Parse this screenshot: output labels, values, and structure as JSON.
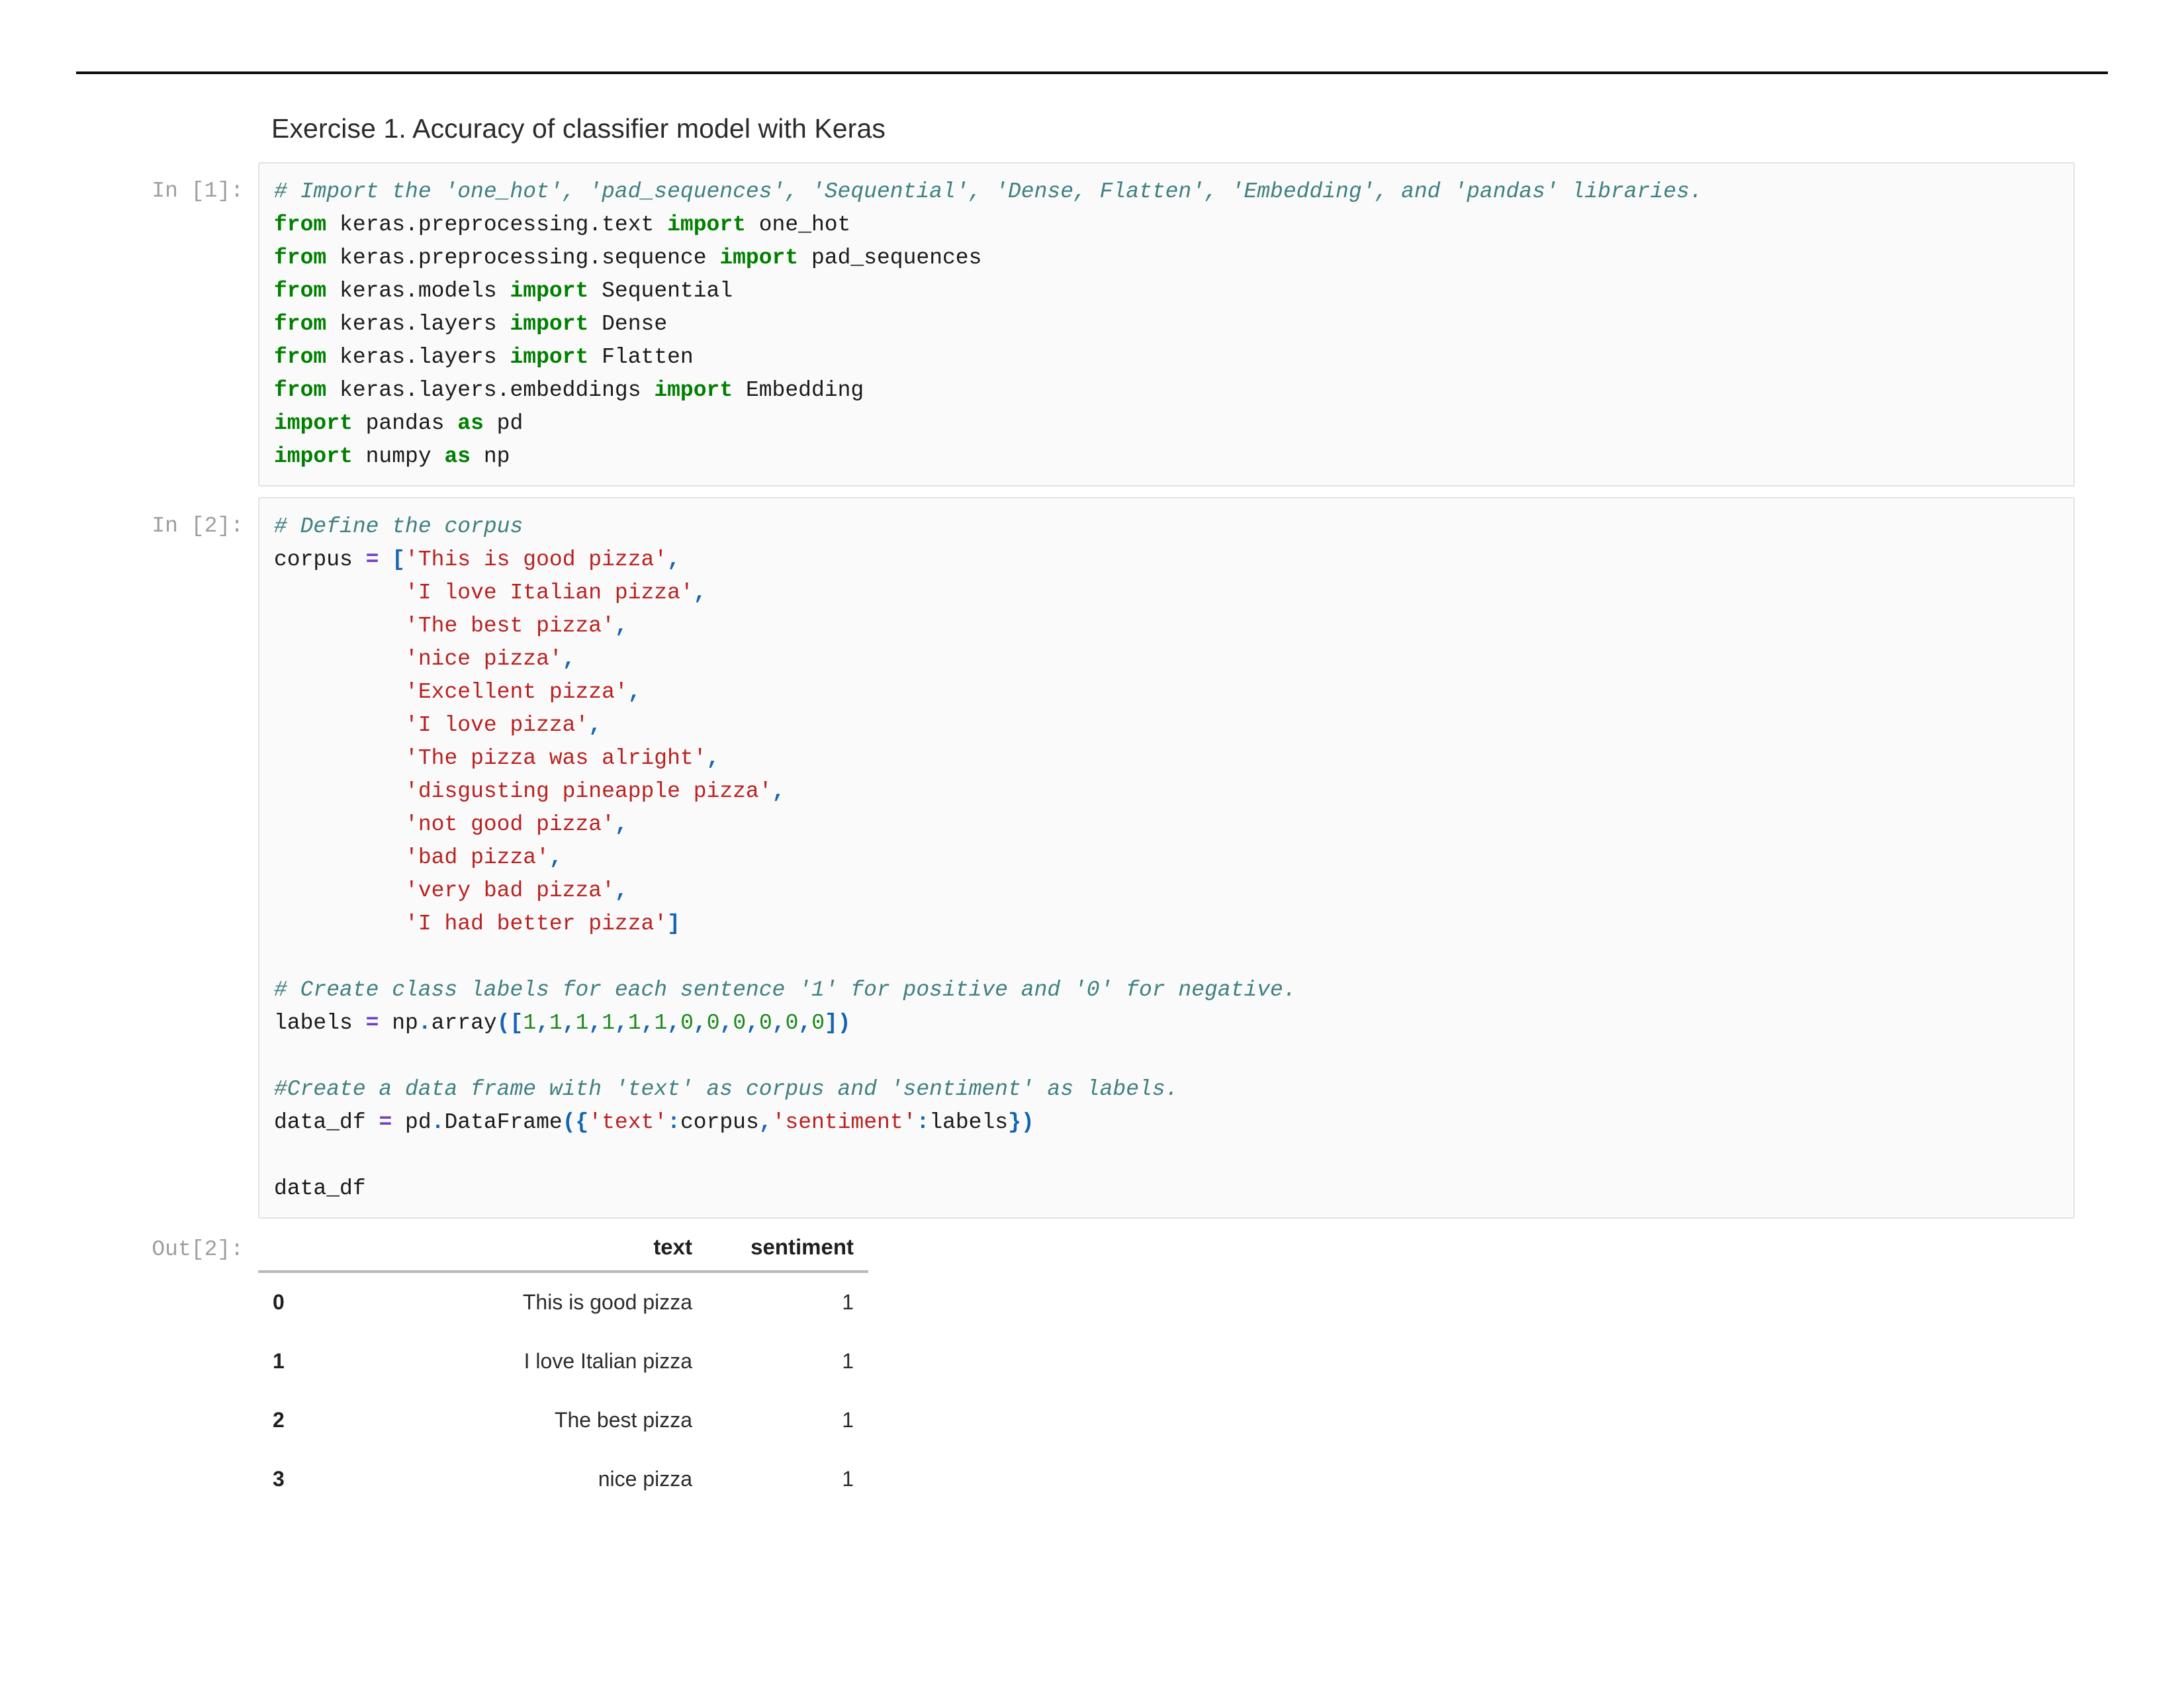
{
  "page": {
    "background": "#ffffff",
    "rule_color": "#0d0d0d"
  },
  "heading": {
    "text": "Exercise 1. Accuracy of classifier model with Keras"
  },
  "cells": [
    {
      "prompt": "In [1]:",
      "lines": [
        [
          {
            "t": "comment",
            "s": "# Import the 'one_hot', 'pad_sequences', 'Sequential', 'Dense, Flatten', 'Embedding', and 'pandas' libraries."
          }
        ],
        [
          {
            "t": "keyword",
            "s": "from"
          },
          {
            "t": "plain",
            "s": " keras.preprocessing.text "
          },
          {
            "t": "keyword",
            "s": "import"
          },
          {
            "t": "plain",
            "s": " one_hot"
          }
        ],
        [
          {
            "t": "keyword",
            "s": "from"
          },
          {
            "t": "plain",
            "s": " keras.preprocessing.sequence "
          },
          {
            "t": "keyword",
            "s": "import"
          },
          {
            "t": "plain",
            "s": " pad_sequences"
          }
        ],
        [
          {
            "t": "keyword",
            "s": "from"
          },
          {
            "t": "plain",
            "s": " keras.models "
          },
          {
            "t": "keyword",
            "s": "import"
          },
          {
            "t": "plain",
            "s": " Sequential"
          }
        ],
        [
          {
            "t": "keyword",
            "s": "from"
          },
          {
            "t": "plain",
            "s": " keras.layers "
          },
          {
            "t": "keyword",
            "s": "import"
          },
          {
            "t": "plain",
            "s": " Dense"
          }
        ],
        [
          {
            "t": "keyword",
            "s": "from"
          },
          {
            "t": "plain",
            "s": " keras.layers "
          },
          {
            "t": "keyword",
            "s": "import"
          },
          {
            "t": "plain",
            "s": " Flatten"
          }
        ],
        [
          {
            "t": "keyword",
            "s": "from"
          },
          {
            "t": "plain",
            "s": " keras.layers.embeddings "
          },
          {
            "t": "keyword",
            "s": "import"
          },
          {
            "t": "plain",
            "s": " Embedding"
          }
        ],
        [
          {
            "t": "keyword",
            "s": "import"
          },
          {
            "t": "plain",
            "s": " pandas "
          },
          {
            "t": "keyword",
            "s": "as"
          },
          {
            "t": "plain",
            "s": " pd"
          }
        ],
        [
          {
            "t": "keyword",
            "s": "import"
          },
          {
            "t": "plain",
            "s": " numpy "
          },
          {
            "t": "keyword",
            "s": "as"
          },
          {
            "t": "plain",
            "s": " np"
          }
        ]
      ]
    },
    {
      "prompt": "In [2]:",
      "lines": [
        [
          {
            "t": "comment",
            "s": "# Define the corpus"
          }
        ],
        [
          {
            "t": "plain",
            "s": "corpus "
          },
          {
            "t": "operator",
            "s": "="
          },
          {
            "t": "plain",
            "s": " "
          },
          {
            "t": "punct",
            "s": "["
          },
          {
            "t": "string",
            "s": "'This is good pizza'"
          },
          {
            "t": "punct",
            "s": ","
          }
        ],
        [
          {
            "t": "plain",
            "s": "          "
          },
          {
            "t": "string",
            "s": "'I love Italian pizza'"
          },
          {
            "t": "punct",
            "s": ","
          }
        ],
        [
          {
            "t": "plain",
            "s": "          "
          },
          {
            "t": "string",
            "s": "'The best pizza'"
          },
          {
            "t": "punct",
            "s": ","
          }
        ],
        [
          {
            "t": "plain",
            "s": "          "
          },
          {
            "t": "string",
            "s": "'nice pizza'"
          },
          {
            "t": "punct",
            "s": ","
          }
        ],
        [
          {
            "t": "plain",
            "s": "          "
          },
          {
            "t": "string",
            "s": "'Excellent pizza'"
          },
          {
            "t": "punct",
            "s": ","
          }
        ],
        [
          {
            "t": "plain",
            "s": "          "
          },
          {
            "t": "string",
            "s": "'I love pizza'"
          },
          {
            "t": "punct",
            "s": ","
          }
        ],
        [
          {
            "t": "plain",
            "s": "          "
          },
          {
            "t": "string",
            "s": "'The pizza was alright'"
          },
          {
            "t": "punct",
            "s": ","
          }
        ],
        [
          {
            "t": "plain",
            "s": "          "
          },
          {
            "t": "string",
            "s": "'disgusting pineapple pizza'"
          },
          {
            "t": "punct",
            "s": ","
          }
        ],
        [
          {
            "t": "plain",
            "s": "          "
          },
          {
            "t": "string",
            "s": "'not good pizza'"
          },
          {
            "t": "punct",
            "s": ","
          }
        ],
        [
          {
            "t": "plain",
            "s": "          "
          },
          {
            "t": "string",
            "s": "'bad pizza'"
          },
          {
            "t": "punct",
            "s": ","
          }
        ],
        [
          {
            "t": "plain",
            "s": "          "
          },
          {
            "t": "string",
            "s": "'very bad pizza'"
          },
          {
            "t": "punct",
            "s": ","
          }
        ],
        [
          {
            "t": "plain",
            "s": "          "
          },
          {
            "t": "string",
            "s": "'I had better pizza'"
          },
          {
            "t": "punct",
            "s": "]"
          }
        ],
        [
          {
            "t": "plain",
            "s": ""
          }
        ],
        [
          {
            "t": "comment",
            "s": "# Create class labels for each sentence '1' for positive and '0' for negative."
          }
        ],
        [
          {
            "t": "plain",
            "s": "labels "
          },
          {
            "t": "operator",
            "s": "="
          },
          {
            "t": "plain",
            "s": " np"
          },
          {
            "t": "punct",
            "s": "."
          },
          {
            "t": "plain",
            "s": "array"
          },
          {
            "t": "punct",
            "s": "(["
          },
          {
            "t": "number",
            "s": "1"
          },
          {
            "t": "punct",
            "s": ","
          },
          {
            "t": "number",
            "s": "1"
          },
          {
            "t": "punct",
            "s": ","
          },
          {
            "t": "number",
            "s": "1"
          },
          {
            "t": "punct",
            "s": ","
          },
          {
            "t": "number",
            "s": "1"
          },
          {
            "t": "punct",
            "s": ","
          },
          {
            "t": "number",
            "s": "1"
          },
          {
            "t": "punct",
            "s": ","
          },
          {
            "t": "number",
            "s": "1"
          },
          {
            "t": "punct",
            "s": ","
          },
          {
            "t": "number",
            "s": "0"
          },
          {
            "t": "punct",
            "s": ","
          },
          {
            "t": "number",
            "s": "0"
          },
          {
            "t": "punct",
            "s": ","
          },
          {
            "t": "number",
            "s": "0"
          },
          {
            "t": "punct",
            "s": ","
          },
          {
            "t": "number",
            "s": "0"
          },
          {
            "t": "punct",
            "s": ","
          },
          {
            "t": "number",
            "s": "0"
          },
          {
            "t": "punct",
            "s": ","
          },
          {
            "t": "number",
            "s": "0"
          },
          {
            "t": "punct",
            "s": "])"
          }
        ],
        [
          {
            "t": "plain",
            "s": ""
          }
        ],
        [
          {
            "t": "comment",
            "s": "#Create a data frame with 'text' as corpus and 'sentiment' as labels."
          }
        ],
        [
          {
            "t": "plain",
            "s": "data_df "
          },
          {
            "t": "operator",
            "s": "="
          },
          {
            "t": "plain",
            "s": " pd"
          },
          {
            "t": "punct",
            "s": "."
          },
          {
            "t": "plain",
            "s": "DataFrame"
          },
          {
            "t": "punct",
            "s": "({"
          },
          {
            "t": "string",
            "s": "'text'"
          },
          {
            "t": "punct",
            "s": ":"
          },
          {
            "t": "plain",
            "s": "corpus"
          },
          {
            "t": "punct",
            "s": ","
          },
          {
            "t": "string",
            "s": "'sentiment'"
          },
          {
            "t": "punct",
            "s": ":"
          },
          {
            "t": "plain",
            "s": "labels"
          },
          {
            "t": "punct",
            "s": "})"
          }
        ],
        [
          {
            "t": "plain",
            "s": ""
          }
        ],
        [
          {
            "t": "plain",
            "s": "data_df"
          }
        ]
      ]
    }
  ],
  "output": {
    "prompt": "Out[2]:",
    "table": {
      "index_header": "",
      "columns": [
        "text",
        "sentiment"
      ],
      "rows": [
        {
          "index": "0",
          "text": "This is good pizza",
          "sentiment": "1"
        },
        {
          "index": "1",
          "text": "I love Italian pizza",
          "sentiment": "1"
        },
        {
          "index": "2",
          "text": "The best pizza",
          "sentiment": "1"
        },
        {
          "index": "3",
          "text": "nice pizza",
          "sentiment": "1"
        }
      ]
    }
  },
  "colors": {
    "comment": "#408080",
    "keyword": "#008000",
    "string": "#ba2121",
    "number": "#1a8a1a",
    "operator": "#6f42c1",
    "punct": "#1464b4",
    "prompt": "#9e9e9e",
    "cell_border": "#e3e3e3",
    "cell_background": "#fafafa"
  }
}
